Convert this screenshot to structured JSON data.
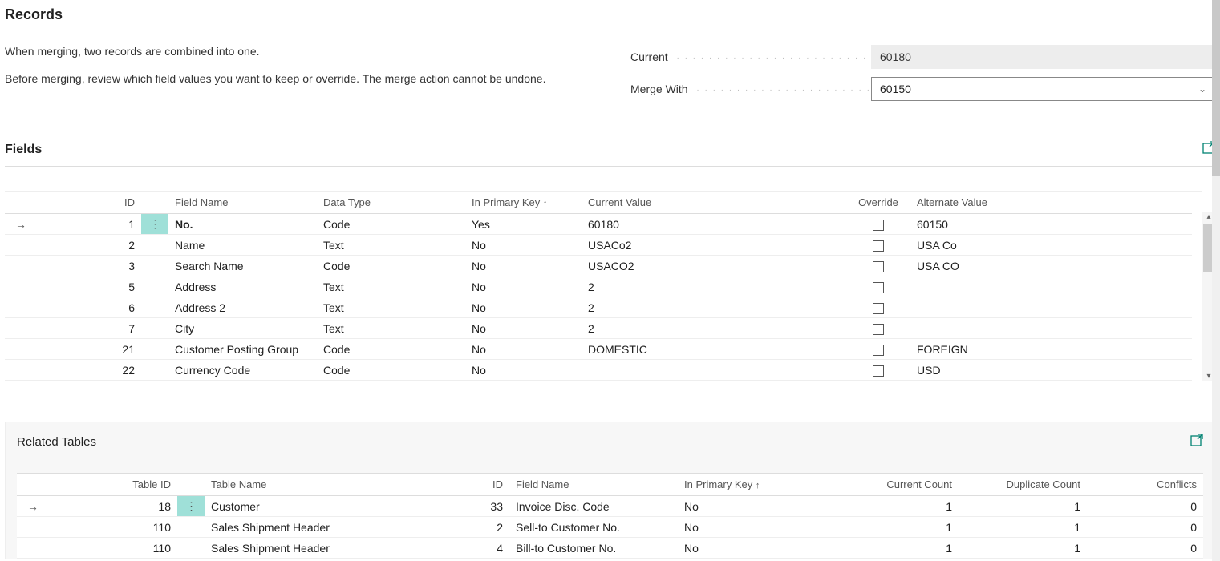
{
  "records": {
    "title": "Records",
    "instruction1": "When merging, two records are combined into one.",
    "instruction2": "Before merging, review which field values you want to keep or override. The merge action cannot be undone.",
    "current_label": "Current",
    "current_value": "60180",
    "mergewith_label": "Merge With",
    "mergewith_value": "60150"
  },
  "fields": {
    "title": "Fields",
    "headers": {
      "id": "ID",
      "field_name": "Field Name",
      "data_type": "Data Type",
      "in_pk": "In Primary Key",
      "current_value": "Current Value",
      "override": "Override",
      "alternate_value": "Alternate Value"
    },
    "rows": [
      {
        "id": "1",
        "field_name": "No.",
        "data_type": "Code",
        "in_pk": "Yes",
        "current_value": "60180",
        "alternate_value": "60150",
        "selected": true
      },
      {
        "id": "2",
        "field_name": "Name",
        "data_type": "Text",
        "in_pk": "No",
        "current_value": "USACo2",
        "alternate_value": "USA Co"
      },
      {
        "id": "3",
        "field_name": "Search Name",
        "data_type": "Code",
        "in_pk": "No",
        "current_value": "USACO2",
        "alternate_value": "USA CO"
      },
      {
        "id": "5",
        "field_name": "Address",
        "data_type": "Text",
        "in_pk": "No",
        "current_value": "2",
        "alternate_value": ""
      },
      {
        "id": "6",
        "field_name": "Address 2",
        "data_type": "Text",
        "in_pk": "No",
        "current_value": "2",
        "alternate_value": ""
      },
      {
        "id": "7",
        "field_name": "City",
        "data_type": "Text",
        "in_pk": "No",
        "current_value": "2",
        "alternate_value": ""
      },
      {
        "id": "21",
        "field_name": "Customer Posting Group",
        "data_type": "Code",
        "in_pk": "No",
        "current_value": "DOMESTIC",
        "alternate_value": "FOREIGN"
      },
      {
        "id": "22",
        "field_name": "Currency Code",
        "data_type": "Code",
        "in_pk": "No",
        "current_value": "",
        "alternate_value": "USD"
      }
    ]
  },
  "related": {
    "title": "Related Tables",
    "headers": {
      "table_id": "Table ID",
      "table_name": "Table Name",
      "id": "ID",
      "field_name": "Field Name",
      "in_pk": "In Primary Key",
      "current_count": "Current Count",
      "duplicate_count": "Duplicate Count",
      "conflicts": "Conflicts"
    },
    "rows": [
      {
        "table_id": "18",
        "table_name": "Customer",
        "id": "33",
        "field_name": "Invoice Disc. Code",
        "in_pk": "No",
        "current_count": "1",
        "duplicate_count": "1",
        "conflicts": "0",
        "selected": true
      },
      {
        "table_id": "110",
        "table_name": "Sales Shipment Header",
        "id": "2",
        "field_name": "Sell-to Customer No.",
        "in_pk": "No",
        "current_count": "1",
        "duplicate_count": "1",
        "conflicts": "0"
      },
      {
        "table_id": "110",
        "table_name": "Sales Shipment Header",
        "id": "4",
        "field_name": "Bill-to Customer No.",
        "in_pk": "No",
        "current_count": "1",
        "duplicate_count": "1",
        "conflicts": "0"
      }
    ]
  }
}
